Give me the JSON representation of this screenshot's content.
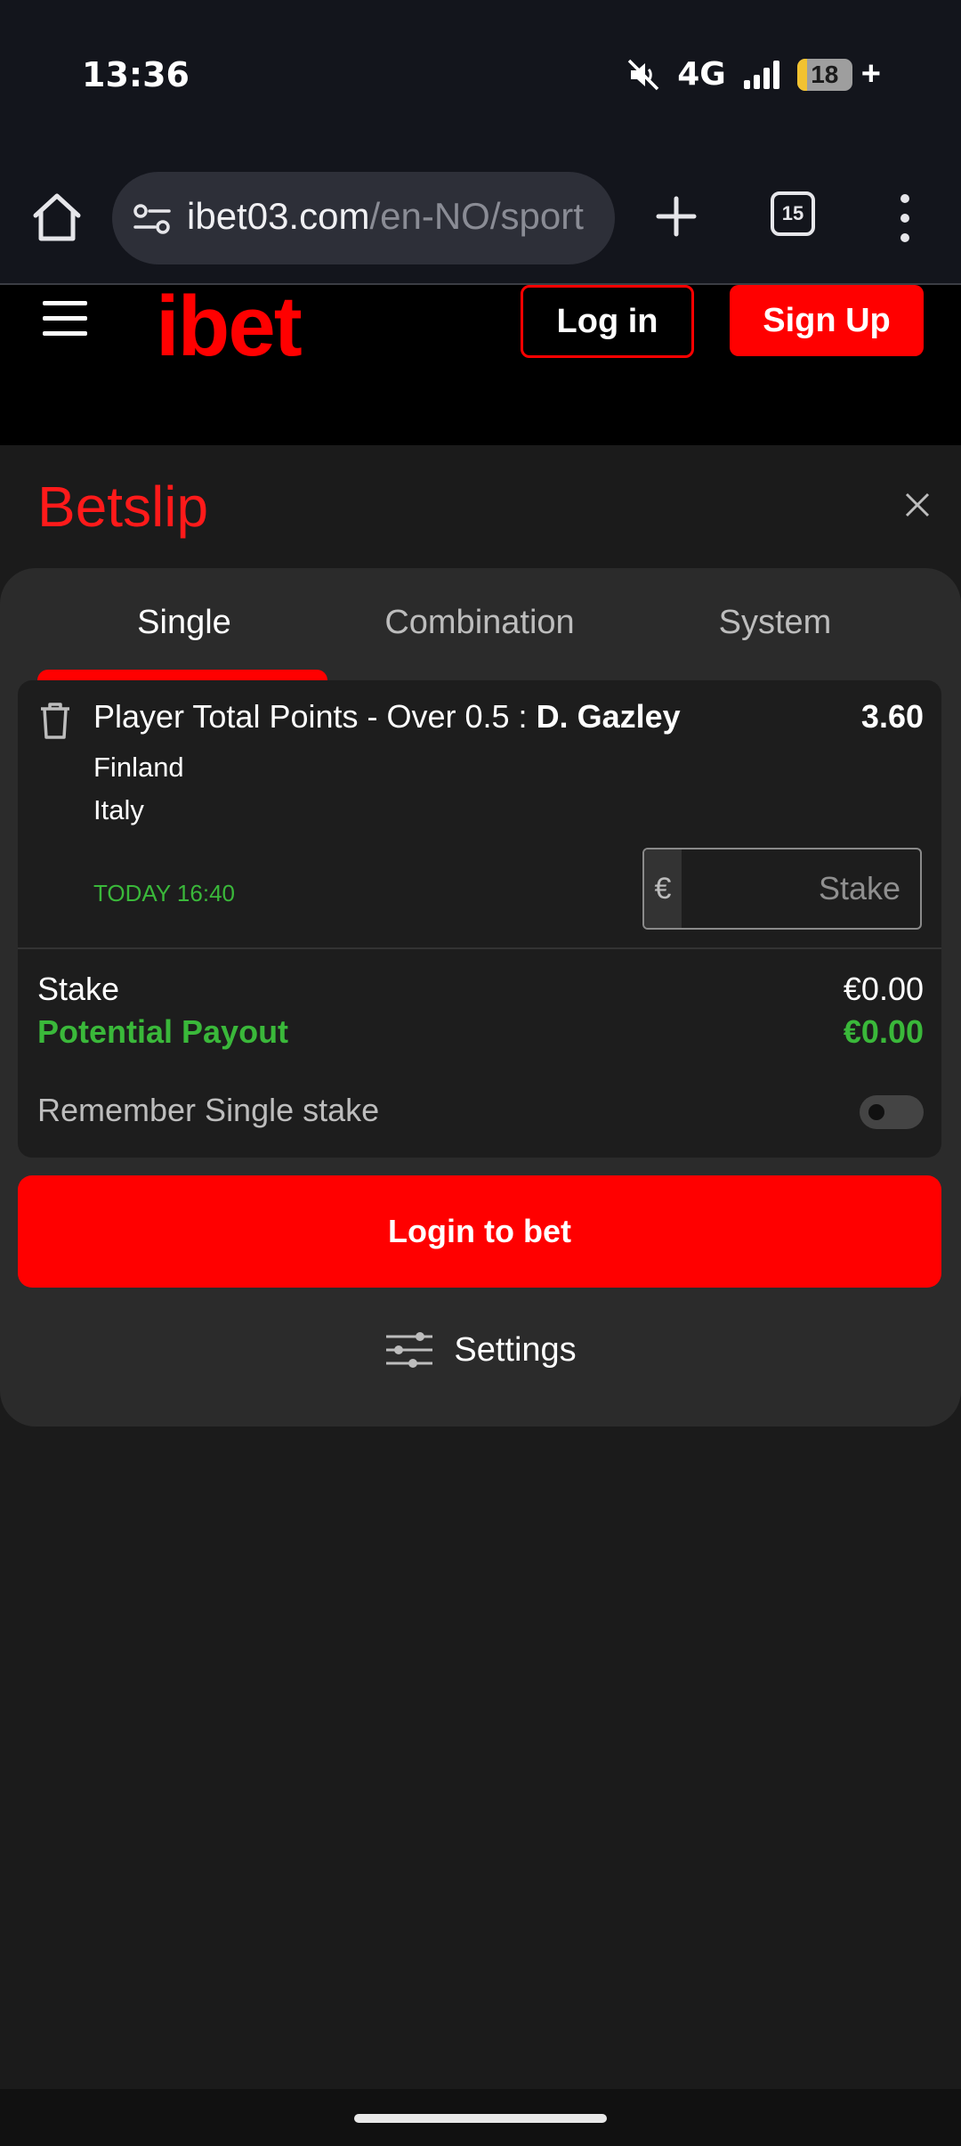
{
  "status_bar": {
    "time": "13:36",
    "network": "4G",
    "battery": "18",
    "battery_level_percent": 18,
    "charging": "+"
  },
  "browser": {
    "url_domain": "ibet03.com",
    "url_path": "/en-NO/sport",
    "tab_count": "15"
  },
  "header": {
    "logo": "ibet",
    "login_label": "Log in",
    "signup_label": "Sign Up"
  },
  "betslip": {
    "title": "Betslip",
    "tabs": [
      {
        "label": "Single",
        "active": true
      },
      {
        "label": "Combination",
        "active": false
      },
      {
        "label": "System",
        "active": false
      }
    ],
    "selection": {
      "market": "Player Total Points - Over 0.5 : ",
      "player": "D. Gazley",
      "odds": "3.60",
      "team_home": "Finland",
      "team_away": "Italy",
      "time": "TODAY 16:40",
      "stake_currency": "€",
      "stake_placeholder": "Stake"
    },
    "summary": {
      "stake_label": "Stake",
      "stake_value": "€0.00",
      "payout_label": "Potential Payout",
      "payout_value": "€0.00",
      "remember_label": "Remember Single stake"
    },
    "login_to_bet_label": "Login to bet",
    "settings_label": "Settings"
  },
  "colors": {
    "accent": "#ff0000",
    "success": "#3ab83a",
    "panel": "#2b2b2b",
    "card": "#1d1d1d"
  }
}
